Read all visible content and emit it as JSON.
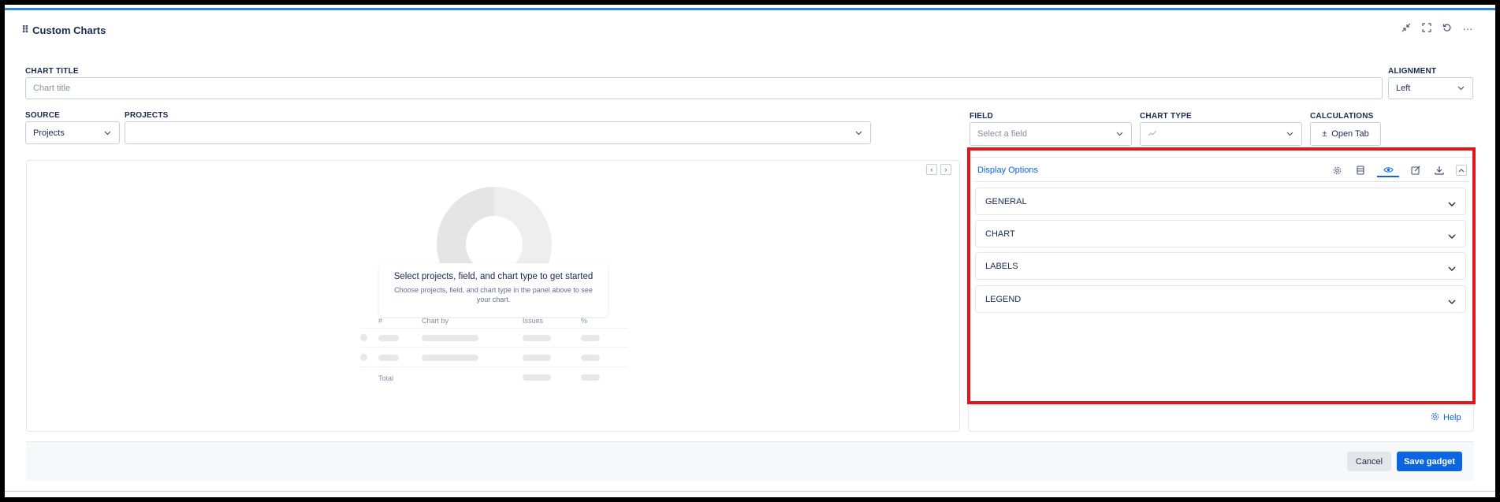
{
  "header": {
    "title": "Custom Charts",
    "actions": [
      "minimize-icon",
      "fullscreen-icon",
      "refresh-icon",
      "more-icon"
    ]
  },
  "chart_title": {
    "label": "CHART TITLE",
    "placeholder": "Chart title",
    "value": ""
  },
  "alignment": {
    "label": "ALIGNMENT",
    "value": "Left"
  },
  "source": {
    "label": "SOURCE",
    "value": "Projects"
  },
  "projects": {
    "label": "PROJECTS",
    "value": ""
  },
  "field": {
    "label": "FIELD",
    "placeholder": "Select a field"
  },
  "chart_type": {
    "label": "CHART TYPE",
    "icon": "line-chart-icon"
  },
  "calculations": {
    "label": "CALCULATIONS",
    "button": "Open Tab"
  },
  "empty_state": {
    "title": "Select projects, field, and chart type to get started",
    "subtitle": "Choose projects, field, and chart type in the panel above to see your chart."
  },
  "skeleton_table": {
    "headers": [
      "#",
      "Chart by",
      "Issues",
      "%"
    ],
    "total_label": "Total"
  },
  "display_options": {
    "title": "Display Options",
    "tools": [
      "settings-icon",
      "table-icon",
      "eye-icon",
      "edit-icon",
      "download-icon"
    ],
    "sections": [
      "GENERAL",
      "CHART",
      "LABELS",
      "LEGEND"
    ]
  },
  "help": {
    "label": "Help"
  },
  "footer": {
    "cancel": "Cancel",
    "save": "Save gadget"
  },
  "colors": {
    "accent": "#0c66e4",
    "highlight": "#e3161b",
    "topline": "#2f86d8"
  }
}
